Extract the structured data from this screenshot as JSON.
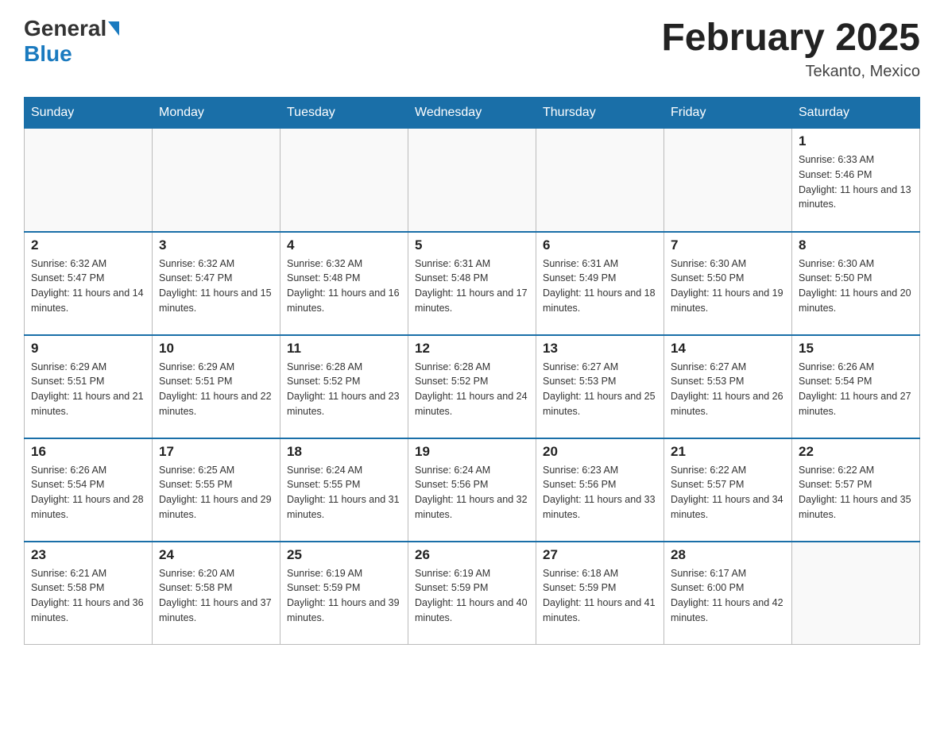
{
  "header": {
    "logo_general": "General",
    "logo_blue": "Blue",
    "month_year": "February 2025",
    "location": "Tekanto, Mexico"
  },
  "weekdays": [
    "Sunday",
    "Monday",
    "Tuesday",
    "Wednesday",
    "Thursday",
    "Friday",
    "Saturday"
  ],
  "weeks": [
    [
      {
        "day": "",
        "info": ""
      },
      {
        "day": "",
        "info": ""
      },
      {
        "day": "",
        "info": ""
      },
      {
        "day": "",
        "info": ""
      },
      {
        "day": "",
        "info": ""
      },
      {
        "day": "",
        "info": ""
      },
      {
        "day": "1",
        "info": "Sunrise: 6:33 AM\nSunset: 5:46 PM\nDaylight: 11 hours and 13 minutes."
      }
    ],
    [
      {
        "day": "2",
        "info": "Sunrise: 6:32 AM\nSunset: 5:47 PM\nDaylight: 11 hours and 14 minutes."
      },
      {
        "day": "3",
        "info": "Sunrise: 6:32 AM\nSunset: 5:47 PM\nDaylight: 11 hours and 15 minutes."
      },
      {
        "day": "4",
        "info": "Sunrise: 6:32 AM\nSunset: 5:48 PM\nDaylight: 11 hours and 16 minutes."
      },
      {
        "day": "5",
        "info": "Sunrise: 6:31 AM\nSunset: 5:48 PM\nDaylight: 11 hours and 17 minutes."
      },
      {
        "day": "6",
        "info": "Sunrise: 6:31 AM\nSunset: 5:49 PM\nDaylight: 11 hours and 18 minutes."
      },
      {
        "day": "7",
        "info": "Sunrise: 6:30 AM\nSunset: 5:50 PM\nDaylight: 11 hours and 19 minutes."
      },
      {
        "day": "8",
        "info": "Sunrise: 6:30 AM\nSunset: 5:50 PM\nDaylight: 11 hours and 20 minutes."
      }
    ],
    [
      {
        "day": "9",
        "info": "Sunrise: 6:29 AM\nSunset: 5:51 PM\nDaylight: 11 hours and 21 minutes."
      },
      {
        "day": "10",
        "info": "Sunrise: 6:29 AM\nSunset: 5:51 PM\nDaylight: 11 hours and 22 minutes."
      },
      {
        "day": "11",
        "info": "Sunrise: 6:28 AM\nSunset: 5:52 PM\nDaylight: 11 hours and 23 minutes."
      },
      {
        "day": "12",
        "info": "Sunrise: 6:28 AM\nSunset: 5:52 PM\nDaylight: 11 hours and 24 minutes."
      },
      {
        "day": "13",
        "info": "Sunrise: 6:27 AM\nSunset: 5:53 PM\nDaylight: 11 hours and 25 minutes."
      },
      {
        "day": "14",
        "info": "Sunrise: 6:27 AM\nSunset: 5:53 PM\nDaylight: 11 hours and 26 minutes."
      },
      {
        "day": "15",
        "info": "Sunrise: 6:26 AM\nSunset: 5:54 PM\nDaylight: 11 hours and 27 minutes."
      }
    ],
    [
      {
        "day": "16",
        "info": "Sunrise: 6:26 AM\nSunset: 5:54 PM\nDaylight: 11 hours and 28 minutes."
      },
      {
        "day": "17",
        "info": "Sunrise: 6:25 AM\nSunset: 5:55 PM\nDaylight: 11 hours and 29 minutes."
      },
      {
        "day": "18",
        "info": "Sunrise: 6:24 AM\nSunset: 5:55 PM\nDaylight: 11 hours and 31 minutes."
      },
      {
        "day": "19",
        "info": "Sunrise: 6:24 AM\nSunset: 5:56 PM\nDaylight: 11 hours and 32 minutes."
      },
      {
        "day": "20",
        "info": "Sunrise: 6:23 AM\nSunset: 5:56 PM\nDaylight: 11 hours and 33 minutes."
      },
      {
        "day": "21",
        "info": "Sunrise: 6:22 AM\nSunset: 5:57 PM\nDaylight: 11 hours and 34 minutes."
      },
      {
        "day": "22",
        "info": "Sunrise: 6:22 AM\nSunset: 5:57 PM\nDaylight: 11 hours and 35 minutes."
      }
    ],
    [
      {
        "day": "23",
        "info": "Sunrise: 6:21 AM\nSunset: 5:58 PM\nDaylight: 11 hours and 36 minutes."
      },
      {
        "day": "24",
        "info": "Sunrise: 6:20 AM\nSunset: 5:58 PM\nDaylight: 11 hours and 37 minutes."
      },
      {
        "day": "25",
        "info": "Sunrise: 6:19 AM\nSunset: 5:59 PM\nDaylight: 11 hours and 39 minutes."
      },
      {
        "day": "26",
        "info": "Sunrise: 6:19 AM\nSunset: 5:59 PM\nDaylight: 11 hours and 40 minutes."
      },
      {
        "day": "27",
        "info": "Sunrise: 6:18 AM\nSunset: 5:59 PM\nDaylight: 11 hours and 41 minutes."
      },
      {
        "day": "28",
        "info": "Sunrise: 6:17 AM\nSunset: 6:00 PM\nDaylight: 11 hours and 42 minutes."
      },
      {
        "day": "",
        "info": ""
      }
    ]
  ]
}
